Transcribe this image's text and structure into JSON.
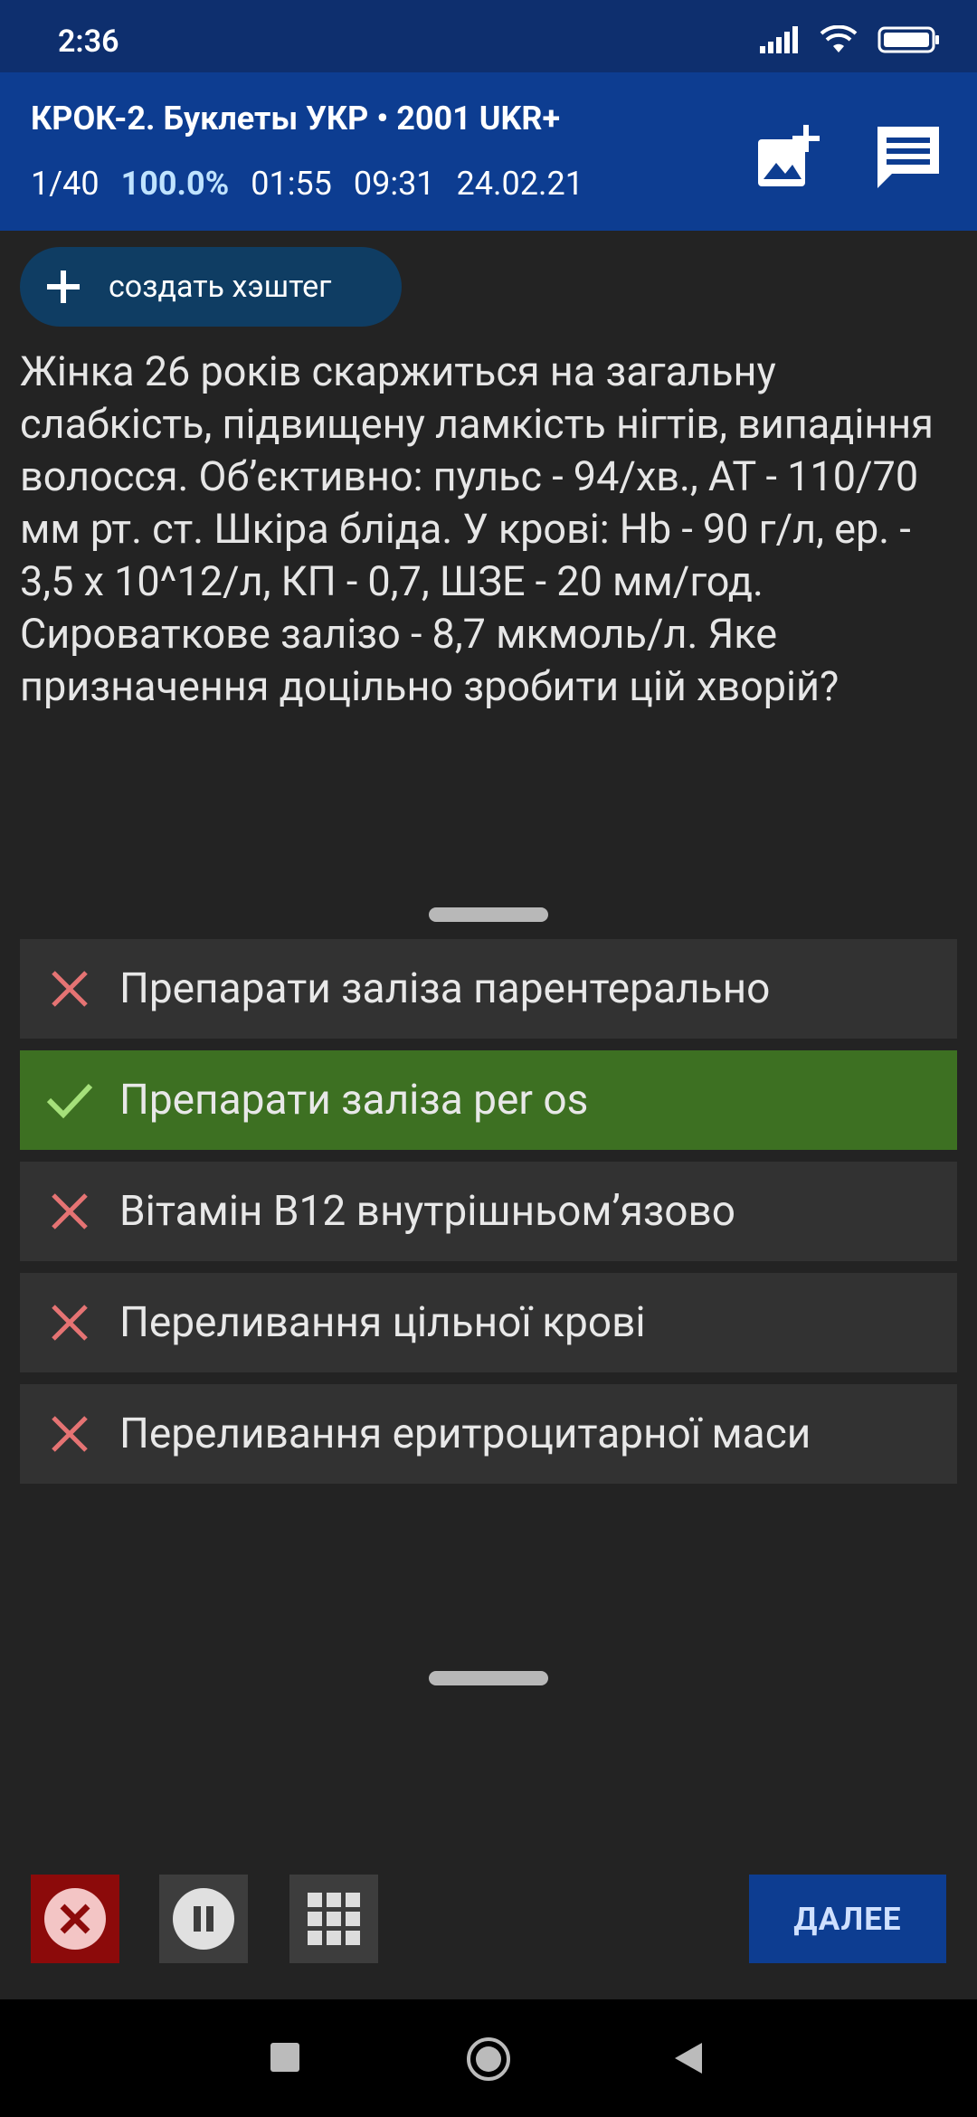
{
  "status_bar": {
    "time": "2:36",
    "icons": [
      "signal-icon",
      "wifi-icon",
      "battery-icon"
    ]
  },
  "header": {
    "title": "КРОК-2. Буклеты УКР • 2001 UKR+",
    "progress": "1/40",
    "percent": "100.0%",
    "timer_question": "01:55",
    "timer_total": "09:31",
    "date": "24.02.21",
    "icons": [
      "add-image-icon",
      "comment-icon"
    ]
  },
  "hashtag_button": {
    "label": "создать хэштег"
  },
  "question": {
    "text": "Жінка 26 років скаржиться на загальну слабкість, підвищену ламкість нігтів, випадіння волосся. Об’єктивно: пульс - 94/хв., АТ - 110/70 мм рт. ст. Шкіра бліда. У крові: Hb - 90 г/л, ер. - 3,5 х 10^12/л, КП - 0,7, ШЗЕ - 20 мм/год. Сироваткове залізо - 8,7 мкмоль/л. Яке призначення доцільно зробити цій хворій?"
  },
  "answers": [
    {
      "text": "Препарати заліза парентерально",
      "correct": false
    },
    {
      "text": "Препарати заліза per os",
      "correct": true
    },
    {
      "text": "Вітамін В12 внутрішньом’язово",
      "correct": false
    },
    {
      "text": "Переливання цільної крові",
      "correct": false
    },
    {
      "text": "Переливання еритроцитарної маси",
      "correct": false
    }
  ],
  "bottom_bar": {
    "next_label": "ДАЛЕЕ"
  },
  "colors": {
    "header": "#0d3d91",
    "status_bar": "#0e2f6e",
    "correct": "#3d7022",
    "wrong_mark": "#e57373",
    "check_mark": "#a5e07a",
    "close_button": "#8c0a0a"
  }
}
